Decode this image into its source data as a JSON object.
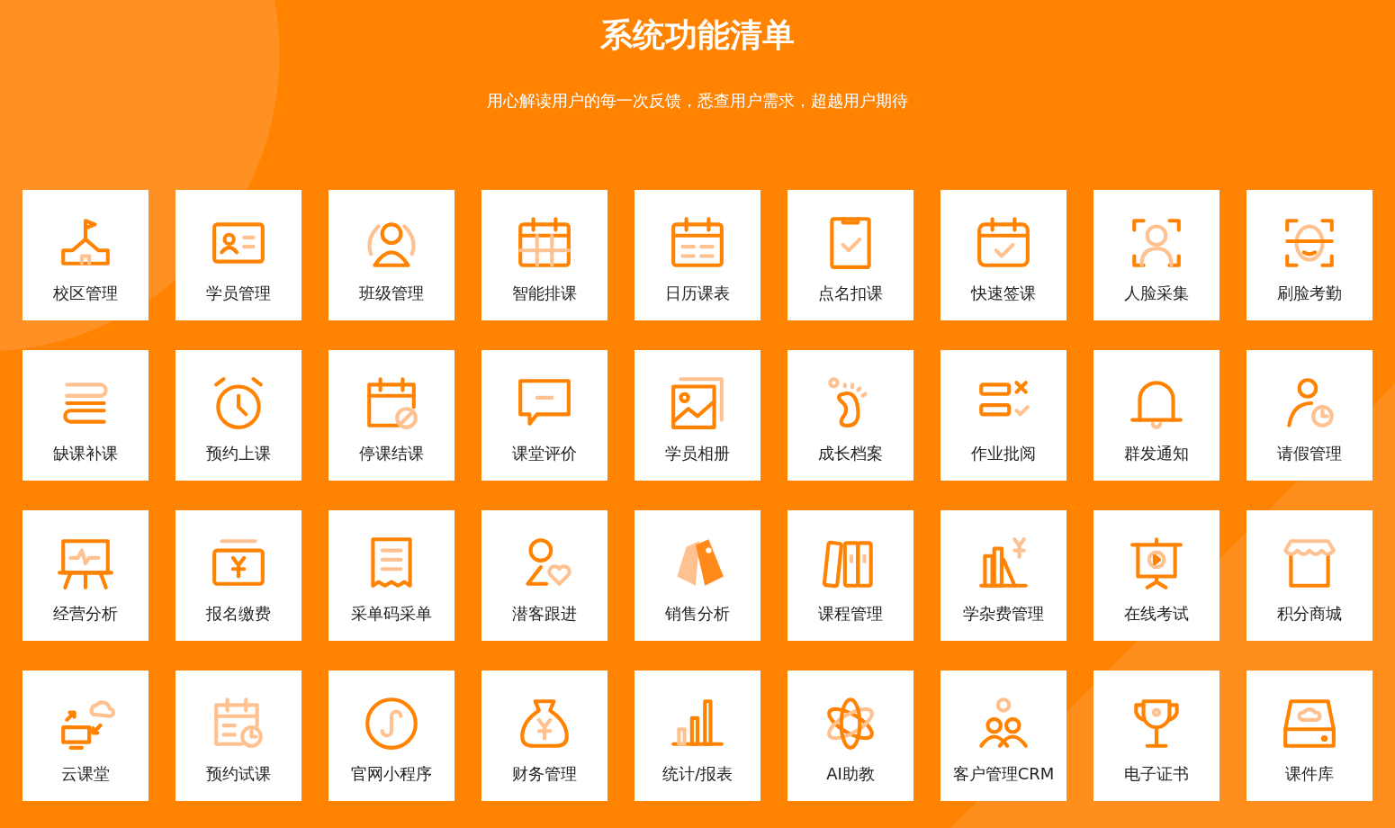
{
  "header": {
    "title": "系统功能清单",
    "subtitle": "用心解读用户的每一次反馈，悉查用户需求，超越用户期待"
  },
  "features": [
    {
      "label": "校区管理"
    },
    {
      "label": "学员管理"
    },
    {
      "label": "班级管理"
    },
    {
      "label": "智能排课"
    },
    {
      "label": "日历课表"
    },
    {
      "label": "点名扣课"
    },
    {
      "label": "快速签课"
    },
    {
      "label": "人脸采集"
    },
    {
      "label": "刷脸考勤"
    },
    {
      "label": "缺课补课"
    },
    {
      "label": "预约上课"
    },
    {
      "label": "停课结课"
    },
    {
      "label": "课堂评价"
    },
    {
      "label": "学员相册"
    },
    {
      "label": "成长档案"
    },
    {
      "label": "作业批阅"
    },
    {
      "label": "群发通知"
    },
    {
      "label": "请假管理"
    },
    {
      "label": "经营分析"
    },
    {
      "label": "报名缴费"
    },
    {
      "label": "采单码采单"
    },
    {
      "label": "潜客跟进"
    },
    {
      "label": "销售分析"
    },
    {
      "label": "课程管理"
    },
    {
      "label": "学杂费管理"
    },
    {
      "label": "在线考试"
    },
    {
      "label": "积分商城"
    },
    {
      "label": "云课堂"
    },
    {
      "label": "预约试课"
    },
    {
      "label": "官网小程序"
    },
    {
      "label": "财务管理"
    },
    {
      "label": "统计/报表"
    },
    {
      "label": "AI助教"
    },
    {
      "label": "客户管理CRM"
    },
    {
      "label": "电子证书"
    },
    {
      "label": "课件库"
    }
  ]
}
